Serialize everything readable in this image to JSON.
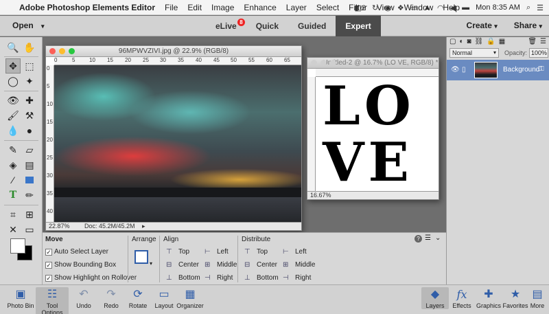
{
  "menubar": {
    "app_name": "Adobe Photoshop Elements Editor",
    "items": [
      "File",
      "Edit",
      "Image",
      "Enhance",
      "Layer",
      "Select",
      "Filter",
      "View",
      "Window",
      "Help"
    ],
    "clock": "Mon 8:35 AM",
    "badge_count": "2"
  },
  "topbar": {
    "open": "Open",
    "tabs": [
      {
        "label": "eLive",
        "badge": "8"
      },
      {
        "label": "Quick"
      },
      {
        "label": "Guided"
      },
      {
        "label": "Expert"
      }
    ],
    "create": "Create",
    "share": "Share"
  },
  "doc1": {
    "title": "96MPWVZIVI.jpg @ 22.9% (RGB/8)",
    "zoom": "22.87%",
    "docsize": "Doc: 45.2M/45.2M",
    "ruler_h": [
      "0",
      "5",
      "10",
      "15",
      "20",
      "25",
      "30",
      "35",
      "40",
      "45",
      "50",
      "55",
      "60",
      "65"
    ],
    "ruler_v": [
      "0",
      "5",
      "10",
      "15",
      "20",
      "25",
      "30",
      "35",
      "40"
    ]
  },
  "doc2": {
    "title": "Untitled-2 @ 16.7% (LO VE, RGB/8) *",
    "line1": "LO",
    "line2": "VE",
    "zoom": "16.67%"
  },
  "options": {
    "move": "Move",
    "auto_select": "Auto Select Layer",
    "show_bbox": "Show Bounding Box",
    "show_highlight": "Show Highlight on Rollover",
    "arrange": "Arrange",
    "align": "Align",
    "distribute": "Distribute",
    "top": "Top",
    "center": "Center",
    "bottom": "Bottom",
    "left": "Left",
    "middle": "Middle",
    "right": "Right"
  },
  "layers": {
    "blend_mode": "Normal",
    "opacity_label": "Opacity:",
    "opacity": "100%",
    "layer_name": "Background"
  },
  "bottombar": {
    "photo_bin": "Photo Bin",
    "tool_options": "Tool Options",
    "undo": "Undo",
    "redo": "Redo",
    "rotate": "Rotate",
    "layout": "Layout",
    "organizer": "Organizer",
    "layers": "Layers",
    "effects": "Effects",
    "graphics": "Graphics",
    "favorites": "Favorites",
    "more": "More"
  }
}
